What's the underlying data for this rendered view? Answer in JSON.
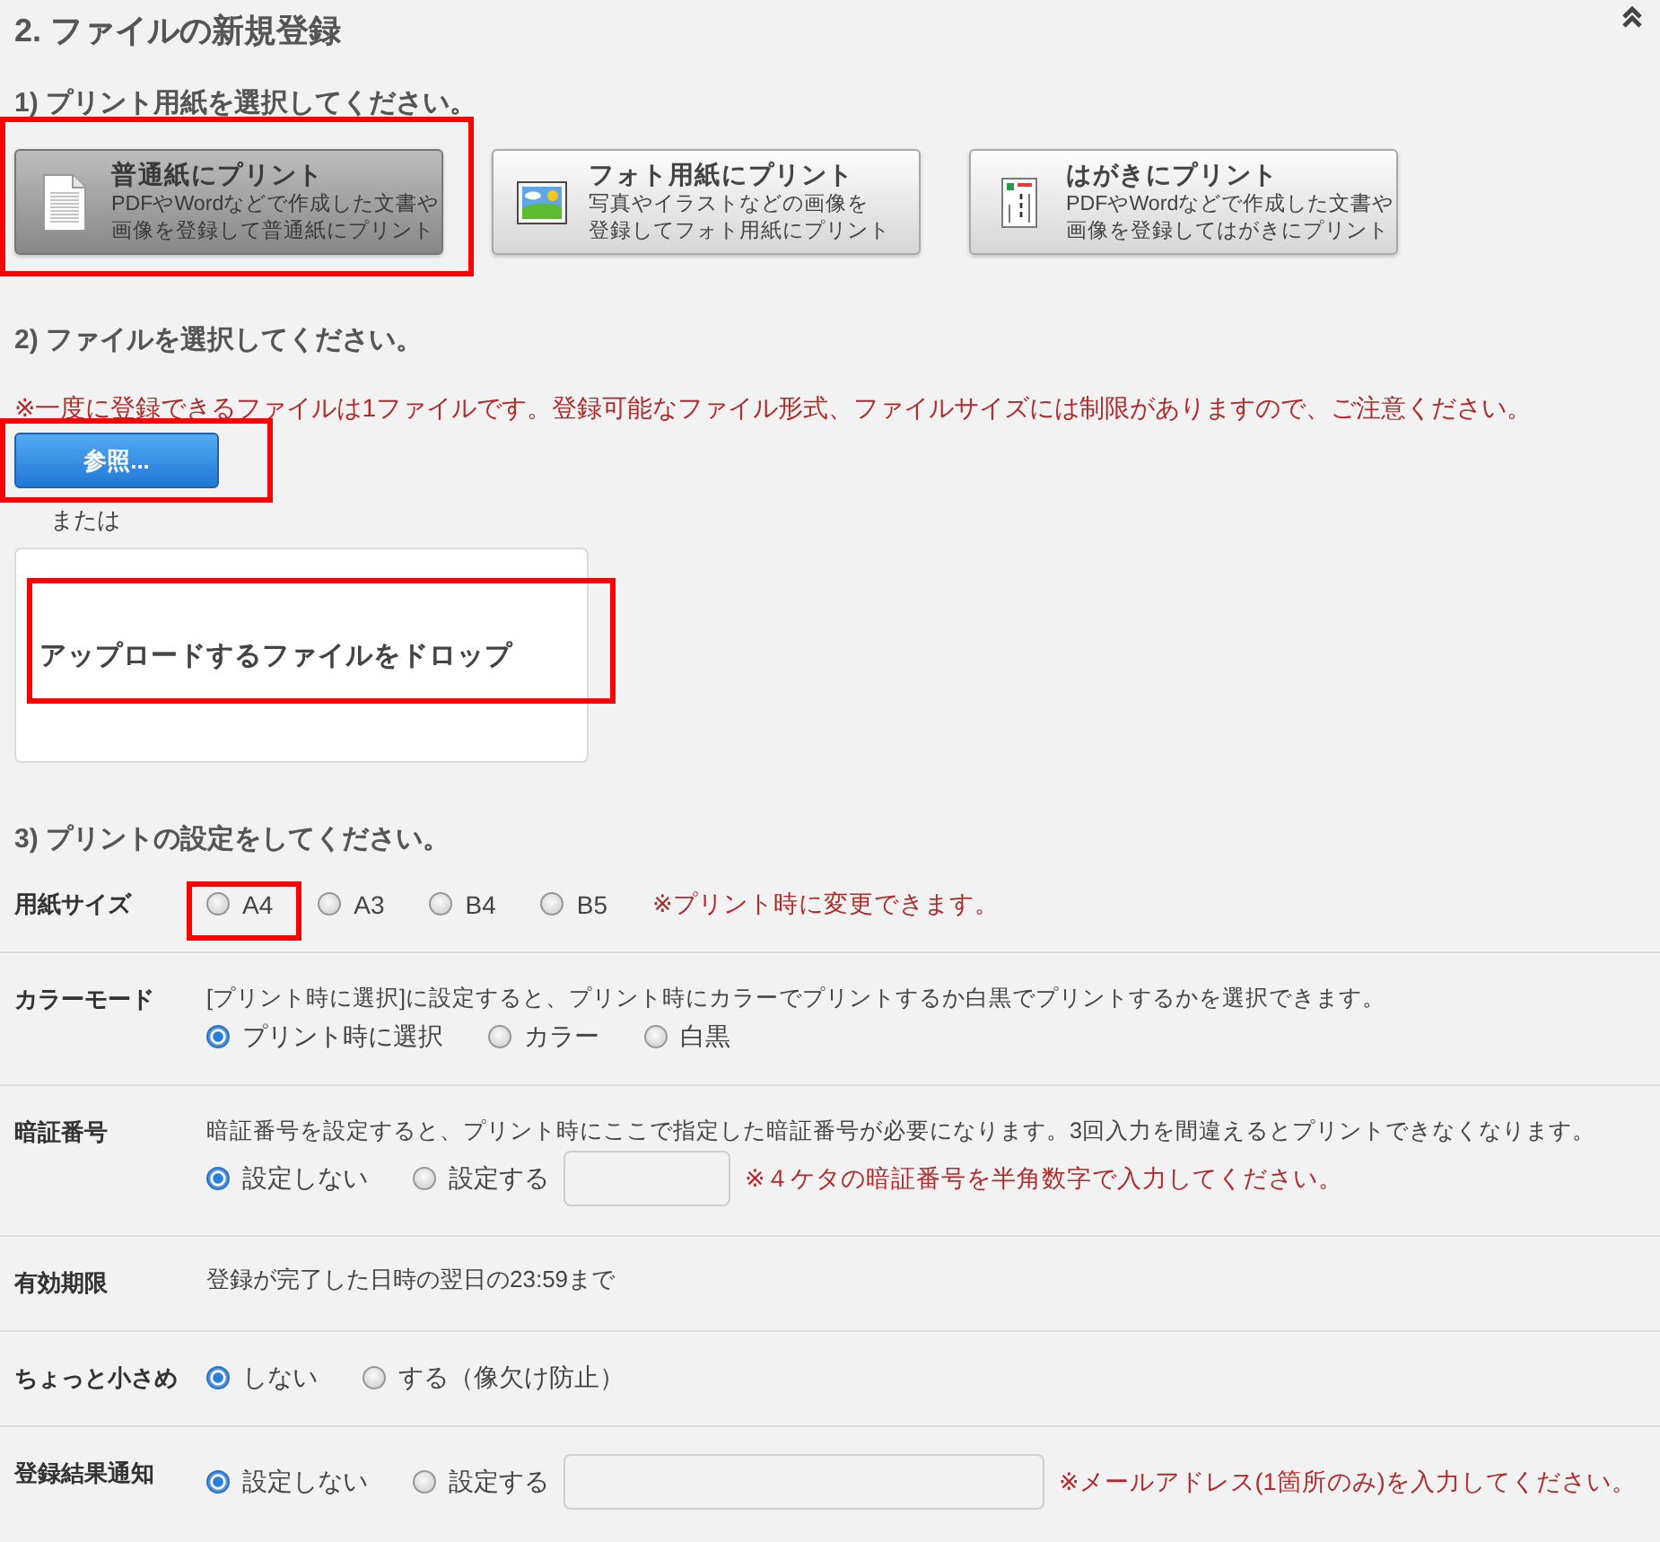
{
  "section": {
    "title": "2. ファイルの新規登録"
  },
  "paper_step": {
    "heading": "1) プリント用紙を選択してください。",
    "options": [
      {
        "kind": "document",
        "title": "普通紙にプリント",
        "description": [
          "PDFやWordなどで作成した文書や",
          "画像を登録して普通紙にプリント"
        ],
        "selected": true,
        "highlighted": true
      },
      {
        "kind": "photo",
        "title": "フォト用紙にプリント",
        "description": [
          "写真やイラストなどの画像を",
          "登録してフォト用紙にプリント"
        ],
        "selected": false,
        "highlighted": false
      },
      {
        "kind": "postcard",
        "title": "はがきにプリント",
        "description": [
          "PDFやWordなどで作成した文書や",
          "画像を登録してはがきにプリント"
        ],
        "selected": false,
        "highlighted": false
      }
    ]
  },
  "file_step": {
    "heading": "2) ファイルを選択してください。",
    "note": "※一度に登録できるファイルは1ファイルです。登録可能なファイル形式、ファイルサイズには制限がありますので、ご注意ください。",
    "browse_button": {
      "label": "参照...",
      "highlighted": true
    },
    "or_text": "または",
    "drop_zone": {
      "label": "アップロードするファイルをドロップ",
      "highlighted": true
    }
  },
  "settings_step": {
    "heading": "3) プリントの設定をしてください。",
    "rows": [
      {
        "kind": "choice",
        "label": "用紙サイズ",
        "options": [
          {
            "label": "A4",
            "selected": false,
            "highlighted": true
          },
          {
            "label": "A3",
            "selected": false,
            "highlighted": false
          },
          {
            "label": "B4",
            "selected": false,
            "highlighted": false
          },
          {
            "label": "B5",
            "selected": false,
            "highlighted": false
          }
        ],
        "note": "※プリント時に変更できます。"
      },
      {
        "kind": "choice",
        "label": "カラーモード",
        "description": "[プリント時に選択]に設定すると、プリント時にカラーでプリントするか白黒でプリントするかを選択できます。",
        "options": [
          {
            "label": "プリント時に選択",
            "selected": true
          },
          {
            "label": "カラー",
            "selected": false
          },
          {
            "label": "白黒",
            "selected": false
          }
        ]
      },
      {
        "kind": "choice",
        "label": "暗証番号",
        "description": "暗証番号を設定すると、プリント時にここで指定した暗証番号が必要になります。3回入力を間違えるとプリントできなくなります。",
        "options": [
          {
            "label": "設定しない",
            "selected": true
          },
          {
            "label": "設定する",
            "selected": false
          }
        ],
        "field": {
          "kind": "pin"
        },
        "note": "※４ケタの暗証番号を半角数字で入力してください。"
      },
      {
        "kind": "text",
        "label": "有効期限",
        "text": "登録が完了した日時の翌日の23:59まで"
      },
      {
        "kind": "choice",
        "label": "ちょっと小さめ",
        "options": [
          {
            "label": "しない",
            "selected": true
          },
          {
            "label": "する（像欠け防止）",
            "selected": false
          }
        ]
      },
      {
        "kind": "choice",
        "label": "登録結果通知",
        "options": [
          {
            "label": "設定しない",
            "selected": true
          },
          {
            "label": "設定する",
            "selected": false
          }
        ],
        "field": {
          "kind": "email"
        },
        "note": "※メールアドレス(1箇所のみ)を入力してください。"
      }
    ]
  }
}
